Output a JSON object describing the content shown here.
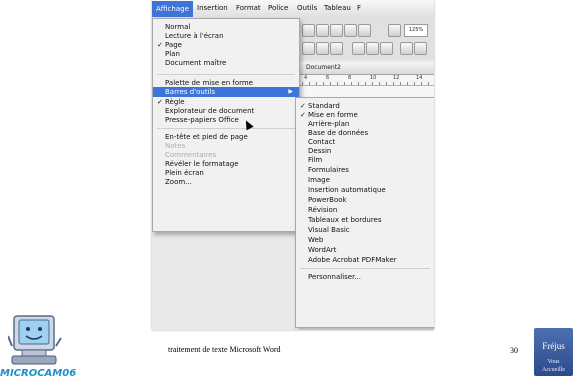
{
  "menubar": {
    "items": [
      "Affichage",
      "Insertion",
      "Format",
      "Police",
      "Outils",
      "Tableau",
      "F"
    ]
  },
  "toolbar": {
    "zoom": "125%",
    "document_title": "Document2",
    "ruler_marks": [
      "4",
      "6",
      "8",
      "10",
      "12",
      "14"
    ]
  },
  "affichage_menu": {
    "items": [
      {
        "label": "Normal",
        "checked": false,
        "disabled": false
      },
      {
        "label": "Lecture à l'écran",
        "checked": false,
        "disabled": false
      },
      {
        "label": "Page",
        "checked": true,
        "disabled": false
      },
      {
        "label": "Plan",
        "checked": false,
        "disabled": false
      },
      {
        "label": "Document maître",
        "checked": false,
        "disabled": false
      },
      {
        "label": "Palette de mise en forme",
        "checked": false,
        "disabled": false
      },
      {
        "label": "Barres d'outils",
        "checked": false,
        "disabled": false,
        "highlighted": true,
        "submenu": true
      },
      {
        "label": "Règle",
        "checked": true,
        "disabled": false
      },
      {
        "label": "Explorateur de document",
        "checked": false,
        "disabled": false
      },
      {
        "label": "Presse-papiers Office",
        "checked": false,
        "disabled": false
      },
      {
        "label": "En-tête et pied de page",
        "checked": false,
        "disabled": false
      },
      {
        "label": "Notes",
        "checked": false,
        "disabled": true
      },
      {
        "label": "Commentaires",
        "checked": false,
        "disabled": true
      },
      {
        "label": "Révéler le formatage",
        "checked": false,
        "disabled": false
      },
      {
        "label": "Plein écran",
        "checked": false,
        "disabled": false
      },
      {
        "label": "Zoom...",
        "checked": false,
        "disabled": false
      }
    ]
  },
  "barres_submenu": {
    "items": [
      {
        "label": "Standard",
        "checked": true
      },
      {
        "label": "Mise en forme",
        "checked": true
      },
      {
        "label": "Arrière-plan",
        "checked": false
      },
      {
        "label": "Base de données",
        "checked": false
      },
      {
        "label": "Contact",
        "checked": false
      },
      {
        "label": "Dessin",
        "checked": false
      },
      {
        "label": "Film",
        "checked": false
      },
      {
        "label": "Formulaires",
        "checked": false
      },
      {
        "label": "Image",
        "checked": false
      },
      {
        "label": "Insertion automatique",
        "checked": false
      },
      {
        "label": "PowerBook",
        "checked": false
      },
      {
        "label": "Révision",
        "checked": false
      },
      {
        "label": "Tableaux et bordures",
        "checked": false
      },
      {
        "label": "Visual Basic",
        "checked": false
      },
      {
        "label": "Web",
        "checked": false
      },
      {
        "label": "WordArt",
        "checked": false
      },
      {
        "label": "Adobe Acrobat PDFMaker",
        "checked": false
      },
      {
        "label": "Personnaliser...",
        "checked": false
      }
    ]
  },
  "footer": {
    "text": "traitement de texte Microsoft Word",
    "page_number": "30"
  },
  "logo": {
    "label": "MICROCAM06"
  },
  "badge": {
    "line1": "Fréjus",
    "line2a": "Vous",
    "line2b": "Accueille"
  },
  "colors": {
    "menu_highlight": "#3c74d8",
    "logo_text": "#1b8fc9",
    "badge": "#3a5a9e"
  }
}
